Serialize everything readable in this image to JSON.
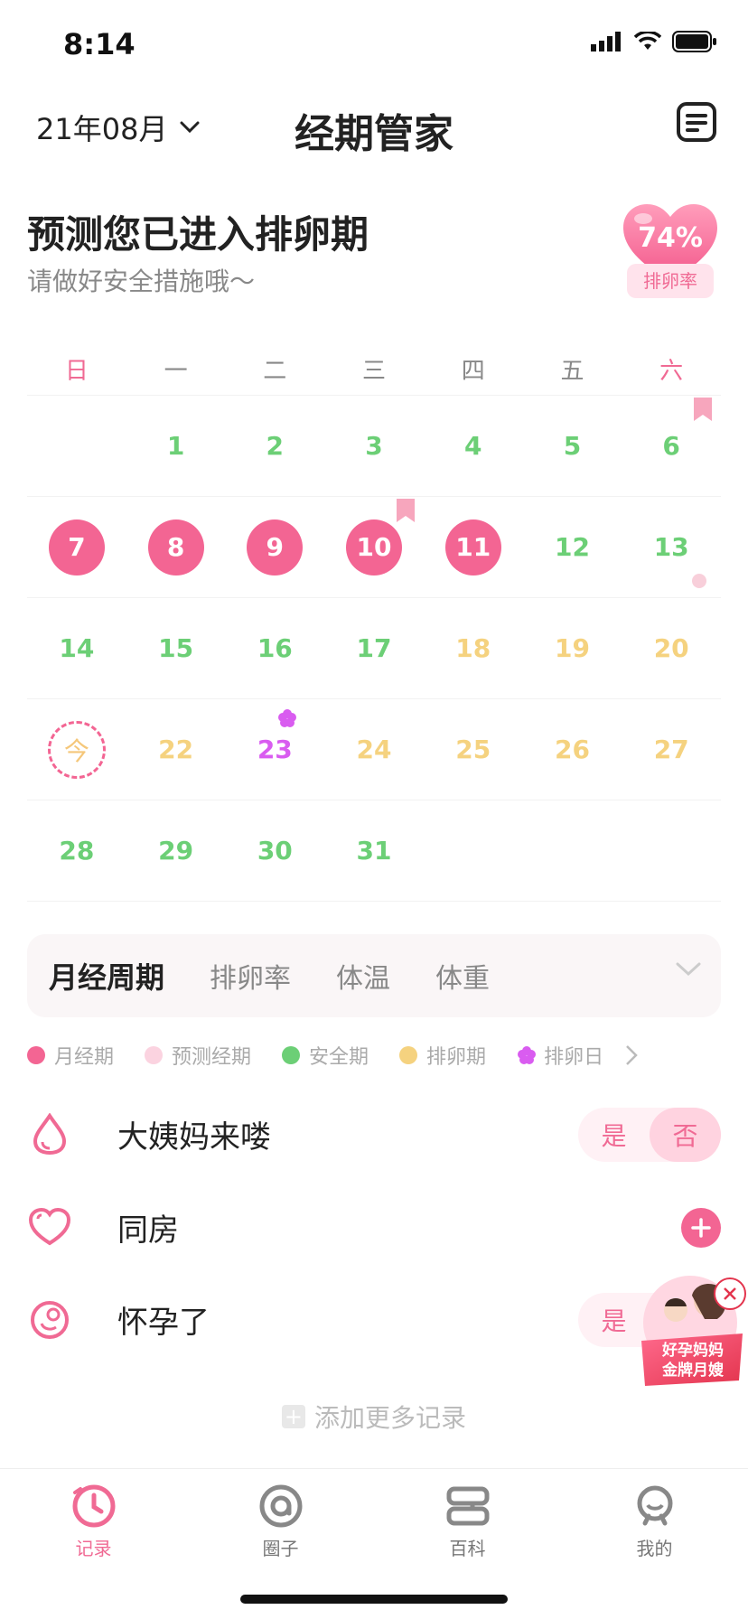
{
  "status_bar": {
    "time": "8:14"
  },
  "header": {
    "month": "21年08月",
    "title": "经期管家"
  },
  "prediction": {
    "title": "预测您已进入排卵期",
    "subtitle": "请做好安全措施哦～",
    "ovulation_rate": "74%",
    "ovulation_rate_label": "排卵率"
  },
  "calendar": {
    "weekdays": [
      "日",
      "一",
      "二",
      "三",
      "四",
      "五",
      "六"
    ],
    "weeks": [
      [
        {
          "day": "",
          "type": "empty"
        },
        {
          "day": "1",
          "type": "safe"
        },
        {
          "day": "2",
          "type": "safe"
        },
        {
          "day": "3",
          "type": "safe"
        },
        {
          "day": "4",
          "type": "safe"
        },
        {
          "day": "5",
          "type": "safe"
        },
        {
          "day": "6",
          "type": "safe"
        }
      ],
      [
        {
          "day": "7",
          "type": "period"
        },
        {
          "day": "8",
          "type": "period"
        },
        {
          "day": "9",
          "type": "period"
        },
        {
          "day": "10",
          "type": "period"
        },
        {
          "day": "11",
          "type": "period"
        },
        {
          "day": "12",
          "type": "safe"
        },
        {
          "day": "13",
          "type": "safe"
        }
      ],
      [
        {
          "day": "14",
          "type": "safe"
        },
        {
          "day": "15",
          "type": "safe"
        },
        {
          "day": "16",
          "type": "safe"
        },
        {
          "day": "17",
          "type": "safe"
        },
        {
          "day": "18",
          "type": "ovulation"
        },
        {
          "day": "19",
          "type": "ovulation"
        },
        {
          "day": "20",
          "type": "ovulation"
        }
      ],
      [
        {
          "day": "今",
          "type": "today"
        },
        {
          "day": "22",
          "type": "ovulation"
        },
        {
          "day": "23",
          "type": "ovulation_day"
        },
        {
          "day": "24",
          "type": "ovulation"
        },
        {
          "day": "25",
          "type": "ovulation"
        },
        {
          "day": "26",
          "type": "ovulation"
        },
        {
          "day": "27",
          "type": "ovulation"
        }
      ],
      [
        {
          "day": "28",
          "type": "safe"
        },
        {
          "day": "29",
          "type": "safe"
        },
        {
          "day": "30",
          "type": "safe"
        },
        {
          "day": "31",
          "type": "safe"
        },
        {
          "day": "",
          "type": "empty"
        },
        {
          "day": "",
          "type": "empty"
        },
        {
          "day": "",
          "type": "empty"
        }
      ]
    ],
    "colors": {
      "period": "#f36593",
      "safe": "#6ccf76",
      "ovulation": "#f5d27f",
      "ovulation_day": "#d95cf0"
    }
  },
  "tabs": [
    "月经周期",
    "排卵率",
    "体温",
    "体重"
  ],
  "legend": [
    {
      "label": "月经期",
      "color": "#f36593"
    },
    {
      "label": "预测经期",
      "color": "#fbd3e0"
    },
    {
      "label": "安全期",
      "color": "#6ccf76"
    },
    {
      "label": "排卵期",
      "color": "#f5d27f"
    },
    {
      "label": "排卵日",
      "color": "#d95cf0"
    }
  ],
  "records": {
    "period": {
      "label": "大姨妈来喽",
      "yes": "是",
      "no": "否"
    },
    "intimacy": {
      "label": "同房"
    },
    "pregnant": {
      "label": "怀孕了",
      "yes": "是"
    },
    "add_more": "添加更多记录"
  },
  "ad": {
    "line1": "好孕妈妈",
    "line2": "金牌月嫂"
  },
  "bottom_nav": [
    {
      "label": "记录",
      "icon": "clock-icon",
      "active": true
    },
    {
      "label": "圈子",
      "icon": "circle-icon",
      "active": false
    },
    {
      "label": "百科",
      "icon": "book-icon",
      "active": false
    },
    {
      "label": "我的",
      "icon": "user-icon",
      "active": false
    }
  ]
}
